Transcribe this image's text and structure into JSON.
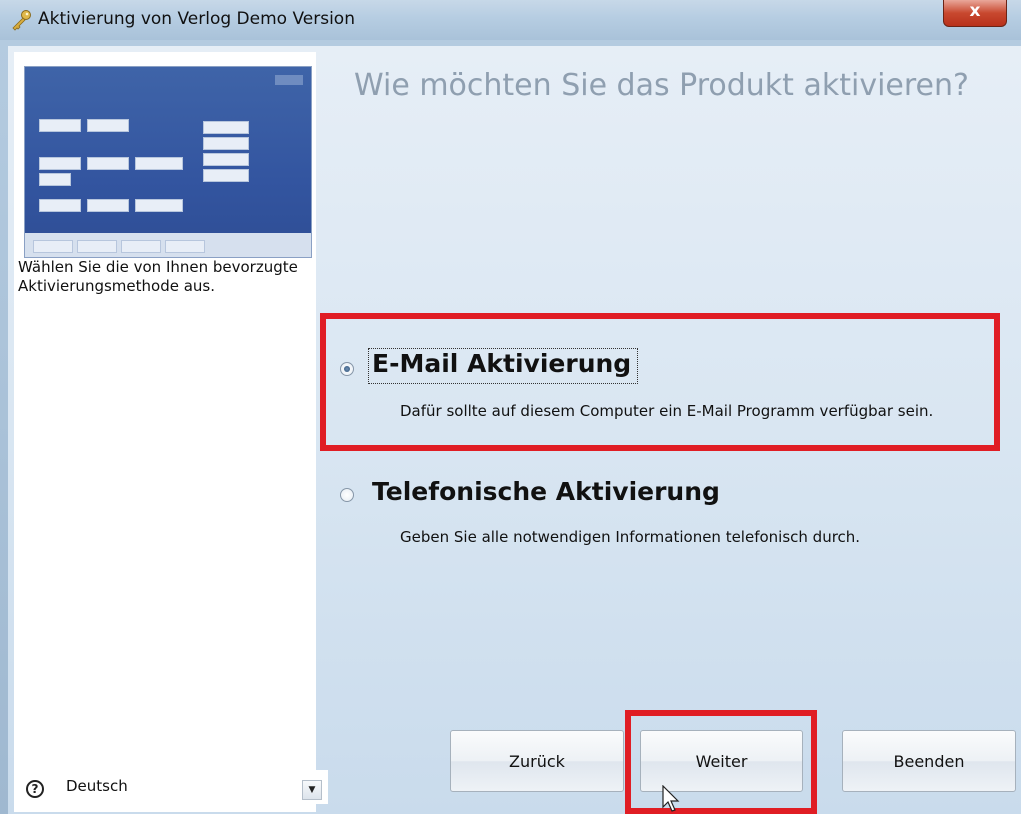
{
  "window": {
    "title": "Aktivierung von Verlog Demo Version",
    "close_label": "x"
  },
  "left_panel": {
    "instruction": "Wählen Sie die von Ihnen bevorzugte Aktivierungsmethode aus."
  },
  "main": {
    "heading": "Wie möchten Sie das Produkt aktivieren?",
    "options": [
      {
        "title": "E-Mail Aktivierung",
        "description": "Dafür sollte auf diesem Computer ein E-Mail Programm verfügbar sein.",
        "selected": true
      },
      {
        "title": "Telefonische Aktivierung",
        "description": "Geben Sie alle notwendigen Informationen telefonisch durch.",
        "selected": false
      }
    ]
  },
  "buttons": {
    "back": "Zurück",
    "next": "Weiter",
    "finish": "Beenden"
  },
  "footer": {
    "help_icon": "?",
    "language": "Deutsch"
  },
  "colors": {
    "highlight": "#e01d24",
    "heading": "#8f9fb0"
  }
}
